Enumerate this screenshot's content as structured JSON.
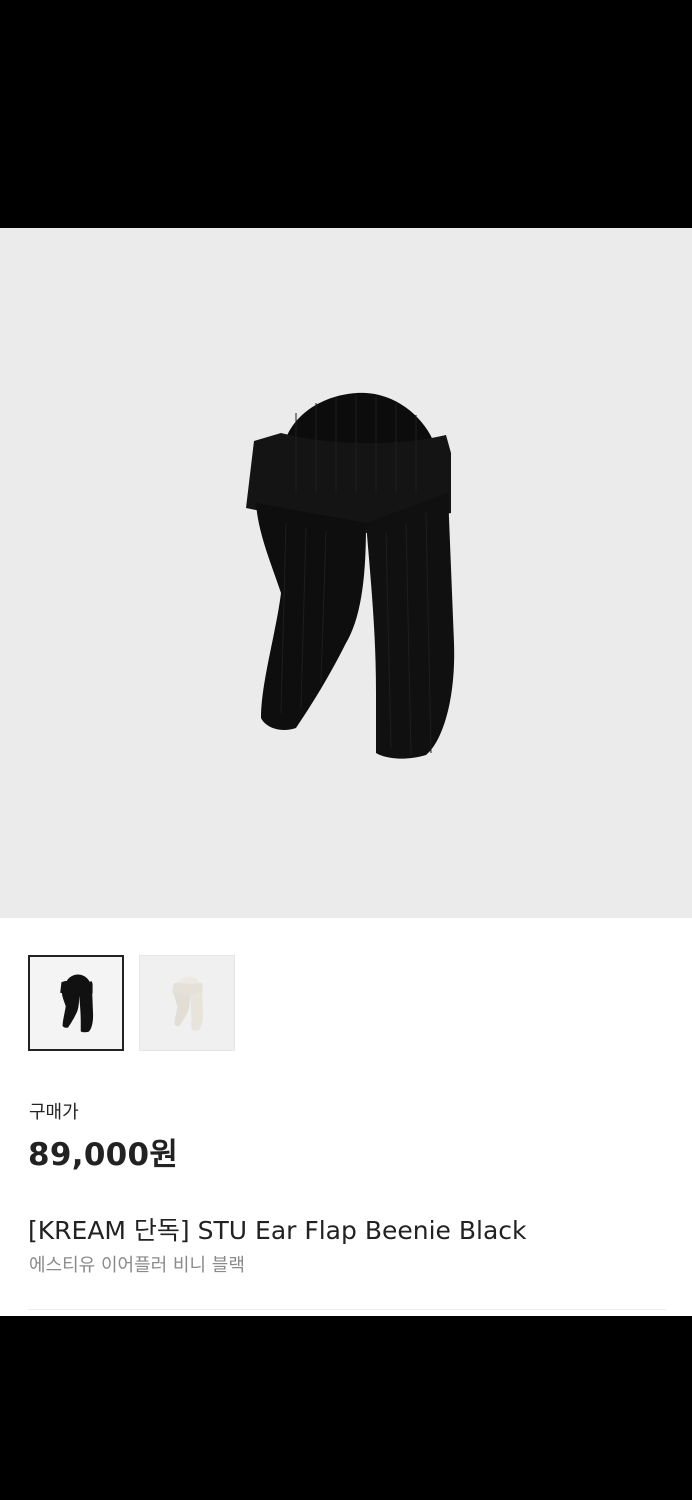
{
  "product": {
    "price_label": "구매가",
    "price": "89,000원",
    "title": "[KREAM 단독] STU Ear Flap Beenie Black",
    "subtitle": "에스티유 이어플러 비니 블랙",
    "main_image": "black ear flap beanie",
    "thumbnails": [
      {
        "image": "black ear flap beanie",
        "color": "#111111",
        "selected": true
      },
      {
        "image": "ivory ear flap beanie",
        "color": "#ece9e2",
        "selected": false
      }
    ]
  },
  "colors": {
    "hero_background": "#ebebeb",
    "text_primary": "#222222",
    "text_secondary": "#8a8a8a",
    "bar_background": "#000000"
  }
}
